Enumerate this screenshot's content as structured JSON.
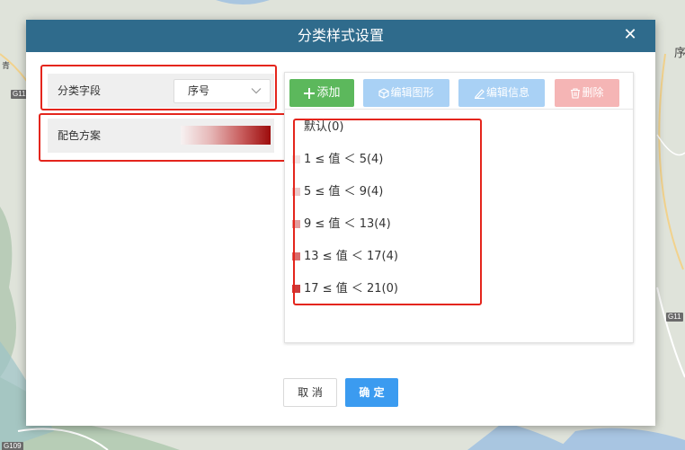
{
  "dialog": {
    "title": "分类样式设置",
    "close_glyph": "✕"
  },
  "classify_field": {
    "label": "分类字段",
    "selected": "序号"
  },
  "color_scheme": {
    "label": "配色方案",
    "ramp_colors": [
      "#f7f2f2",
      "#e6b7b7",
      "#c96060",
      "#9d0b0b"
    ]
  },
  "toolbar": {
    "add_label": "添加",
    "edit_shape_label": "编辑图形",
    "edit_info_label": "编辑信息",
    "delete_label": "删除"
  },
  "classes": [
    {
      "label": "默认(0)",
      "swatch": ""
    },
    {
      "label": "1 ≤ 值 ＜ 5(4)",
      "swatch": "#f3e3e3"
    },
    {
      "label": "5 ≤ 值 ＜ 9(4)",
      "swatch": "#eccaca"
    },
    {
      "label": "9 ≤ 值 ＜ 13(4)",
      "swatch": "#e39d9d"
    },
    {
      "label": "13 ≤ 值 ＜ 17(4)",
      "swatch": "#d96c6c"
    },
    {
      "label": "17 ≤ 值 ＜ 21(0)",
      "swatch": "#cc3c3c"
    }
  ],
  "footer": {
    "cancel_label": "取 消",
    "ok_label": "确 定"
  },
  "map": {
    "road_tags": [
      "G11",
      "G11",
      "G109"
    ],
    "place_text": [
      "青",
      "序"
    ]
  },
  "colors": {
    "header": "#2f6b8c",
    "add": "#5cb85c",
    "edit": "#a9d1f5",
    "delete": "#f5b5b5",
    "ok": "#3b9bf0",
    "highlight": "#e4251c"
  }
}
